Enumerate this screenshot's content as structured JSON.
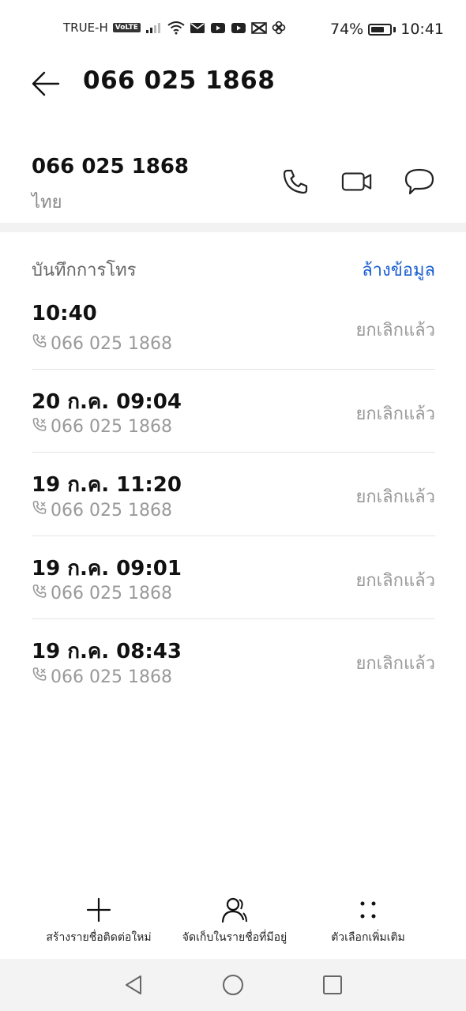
{
  "status_bar": {
    "carrier": "TRUE-H",
    "volte": "VoLTE",
    "battery": "74%",
    "battery_level": 0.74,
    "time": "10:41"
  },
  "header": {
    "title": "066 025 1868"
  },
  "contact": {
    "number": "066 025 1868",
    "region": "ไทย",
    "actions": [
      "phone-icon",
      "video-call-icon",
      "message-icon"
    ]
  },
  "call_log": {
    "title": "บันทึกการโทร",
    "clear_label": "ล้างข้อมูล",
    "entries": [
      {
        "time": "10:40",
        "number": "066 025 1868",
        "status": "ยกเลิกแล้ว"
      },
      {
        "time": "20 ก.ค. 09:04",
        "number": "066 025 1868",
        "status": "ยกเลิกแล้ว"
      },
      {
        "time": "19 ก.ค. 11:20",
        "number": "066 025 1868",
        "status": "ยกเลิกแล้ว"
      },
      {
        "time": "19 ก.ค. 09:01",
        "number": "066 025 1868",
        "status": "ยกเลิกแล้ว"
      },
      {
        "time": "19 ก.ค. 08:43",
        "number": "066 025 1868",
        "status": "ยกเลิกแล้ว"
      }
    ]
  },
  "toolbar": {
    "new_contact": "สร้างรายชื่อติดต่อใหม่",
    "save_existing": "จัดเก็บในรายชื่อที่มีอยู่",
    "more_options": "ตัวเลือกเพิ่มเติม"
  },
  "colors": {
    "accent": "#1a5fd0",
    "secondary_text": "#999999",
    "divider": "#e4e4e4"
  }
}
